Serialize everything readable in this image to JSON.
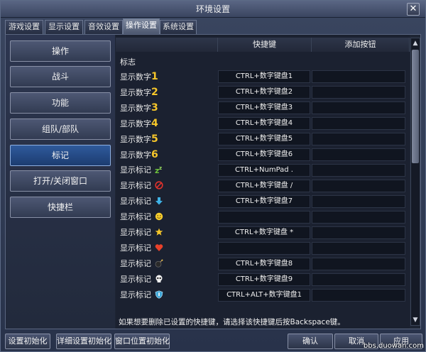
{
  "window": {
    "title": "环境设置"
  },
  "tabs": [
    "游戏设置",
    "显示设置",
    "音效设置",
    "操作设置",
    "系统设置"
  ],
  "active_tab": "操作设置",
  "menu": [
    "操作",
    "战斗",
    "功能",
    "组队/部队",
    "标记",
    "打开/关闭窗口",
    "快捷栏"
  ],
  "active_menu": "标记",
  "columns": {
    "shortcut": "快捷键",
    "add_button": "添加按钮"
  },
  "section": "标志",
  "rows": [
    {
      "label": "显示数字",
      "glyph": "1",
      "shortcut": "CTRL+数字键盘1"
    },
    {
      "label": "显示数字",
      "glyph": "2",
      "shortcut": "CTRL+数字键盘2"
    },
    {
      "label": "显示数字",
      "glyph": "3",
      "shortcut": "CTRL+数字键盘3"
    },
    {
      "label": "显示数字",
      "glyph": "4",
      "shortcut": "CTRL+数字键盘4"
    },
    {
      "label": "显示数字",
      "glyph": "5",
      "shortcut": "CTRL+数字键盘5"
    },
    {
      "label": "显示数字",
      "glyph": "6",
      "shortcut": "CTRL+数字键盘6"
    },
    {
      "label": "显示标记",
      "icon": "zzz-icon",
      "shortcut": "CTRL+NumPad ."
    },
    {
      "label": "显示标记",
      "icon": "prohibited-icon",
      "shortcut": "CTRL+数字键盘 /"
    },
    {
      "label": "显示标记",
      "icon": "down-arrow-icon",
      "shortcut": "CTRL+数字键盘7"
    },
    {
      "label": "显示标记",
      "icon": "smiley-icon",
      "shortcut": ""
    },
    {
      "label": "显示标记",
      "icon": "star-icon",
      "shortcut": "CTRL+数字键盘 *"
    },
    {
      "label": "显示标记",
      "icon": "heart-icon",
      "shortcut": ""
    },
    {
      "label": "显示标记",
      "icon": "bomb-icon",
      "shortcut": "CTRL+数字键盘8"
    },
    {
      "label": "显示标记",
      "icon": "skull-icon",
      "shortcut": "CTRL+数字键盘9"
    },
    {
      "label": "显示标记",
      "icon": "shield-icon",
      "shortcut": "CTRL+ALT+数字键盘1"
    }
  ],
  "hint": "如果想要删除已设置的快捷键，请选择该快捷键后按Backspace键。",
  "bottom": {
    "reset": "设置初始化",
    "reset_detail": "详细设置初始化",
    "reset_window": "窗口位置初始化",
    "ok": "确认",
    "cancel": "取消",
    "apply": "应用"
  },
  "watermark": "bbs.duowan.com",
  "colors": {
    "accent": "#2f5a9c",
    "number_glyph": "#f6c62a"
  }
}
